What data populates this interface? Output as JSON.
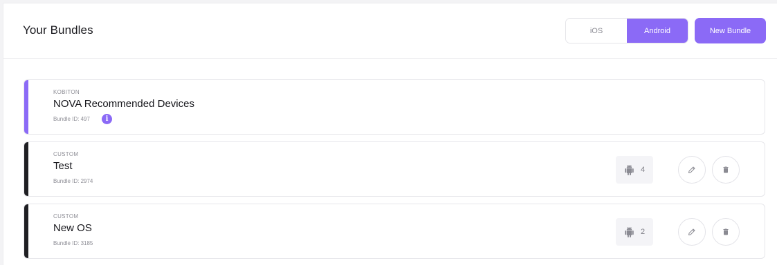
{
  "header": {
    "title": "Your Bundles",
    "platform_toggle": {
      "ios_label": "iOS",
      "android_label": "Android",
      "selected": "Android"
    },
    "new_bundle_label": "New Bundle"
  },
  "colors": {
    "accent": "#8b6af6",
    "custom_bar": "#1f1f23"
  },
  "bundles": [
    {
      "type": "KOBITON",
      "name": "NOVA Recommended Devices",
      "bundle_id": "Bundle ID: 497",
      "info_icon": "info-icon"
    },
    {
      "type": "CUSTOM",
      "name": "Test",
      "bundle_id": "Bundle ID: 2974",
      "device_count": "4",
      "device_icon": "android-icon"
    },
    {
      "type": "CUSTOM",
      "name": "New OS",
      "bundle_id": "Bundle ID: 3185",
      "device_count": "2",
      "device_icon": "android-icon"
    }
  ]
}
